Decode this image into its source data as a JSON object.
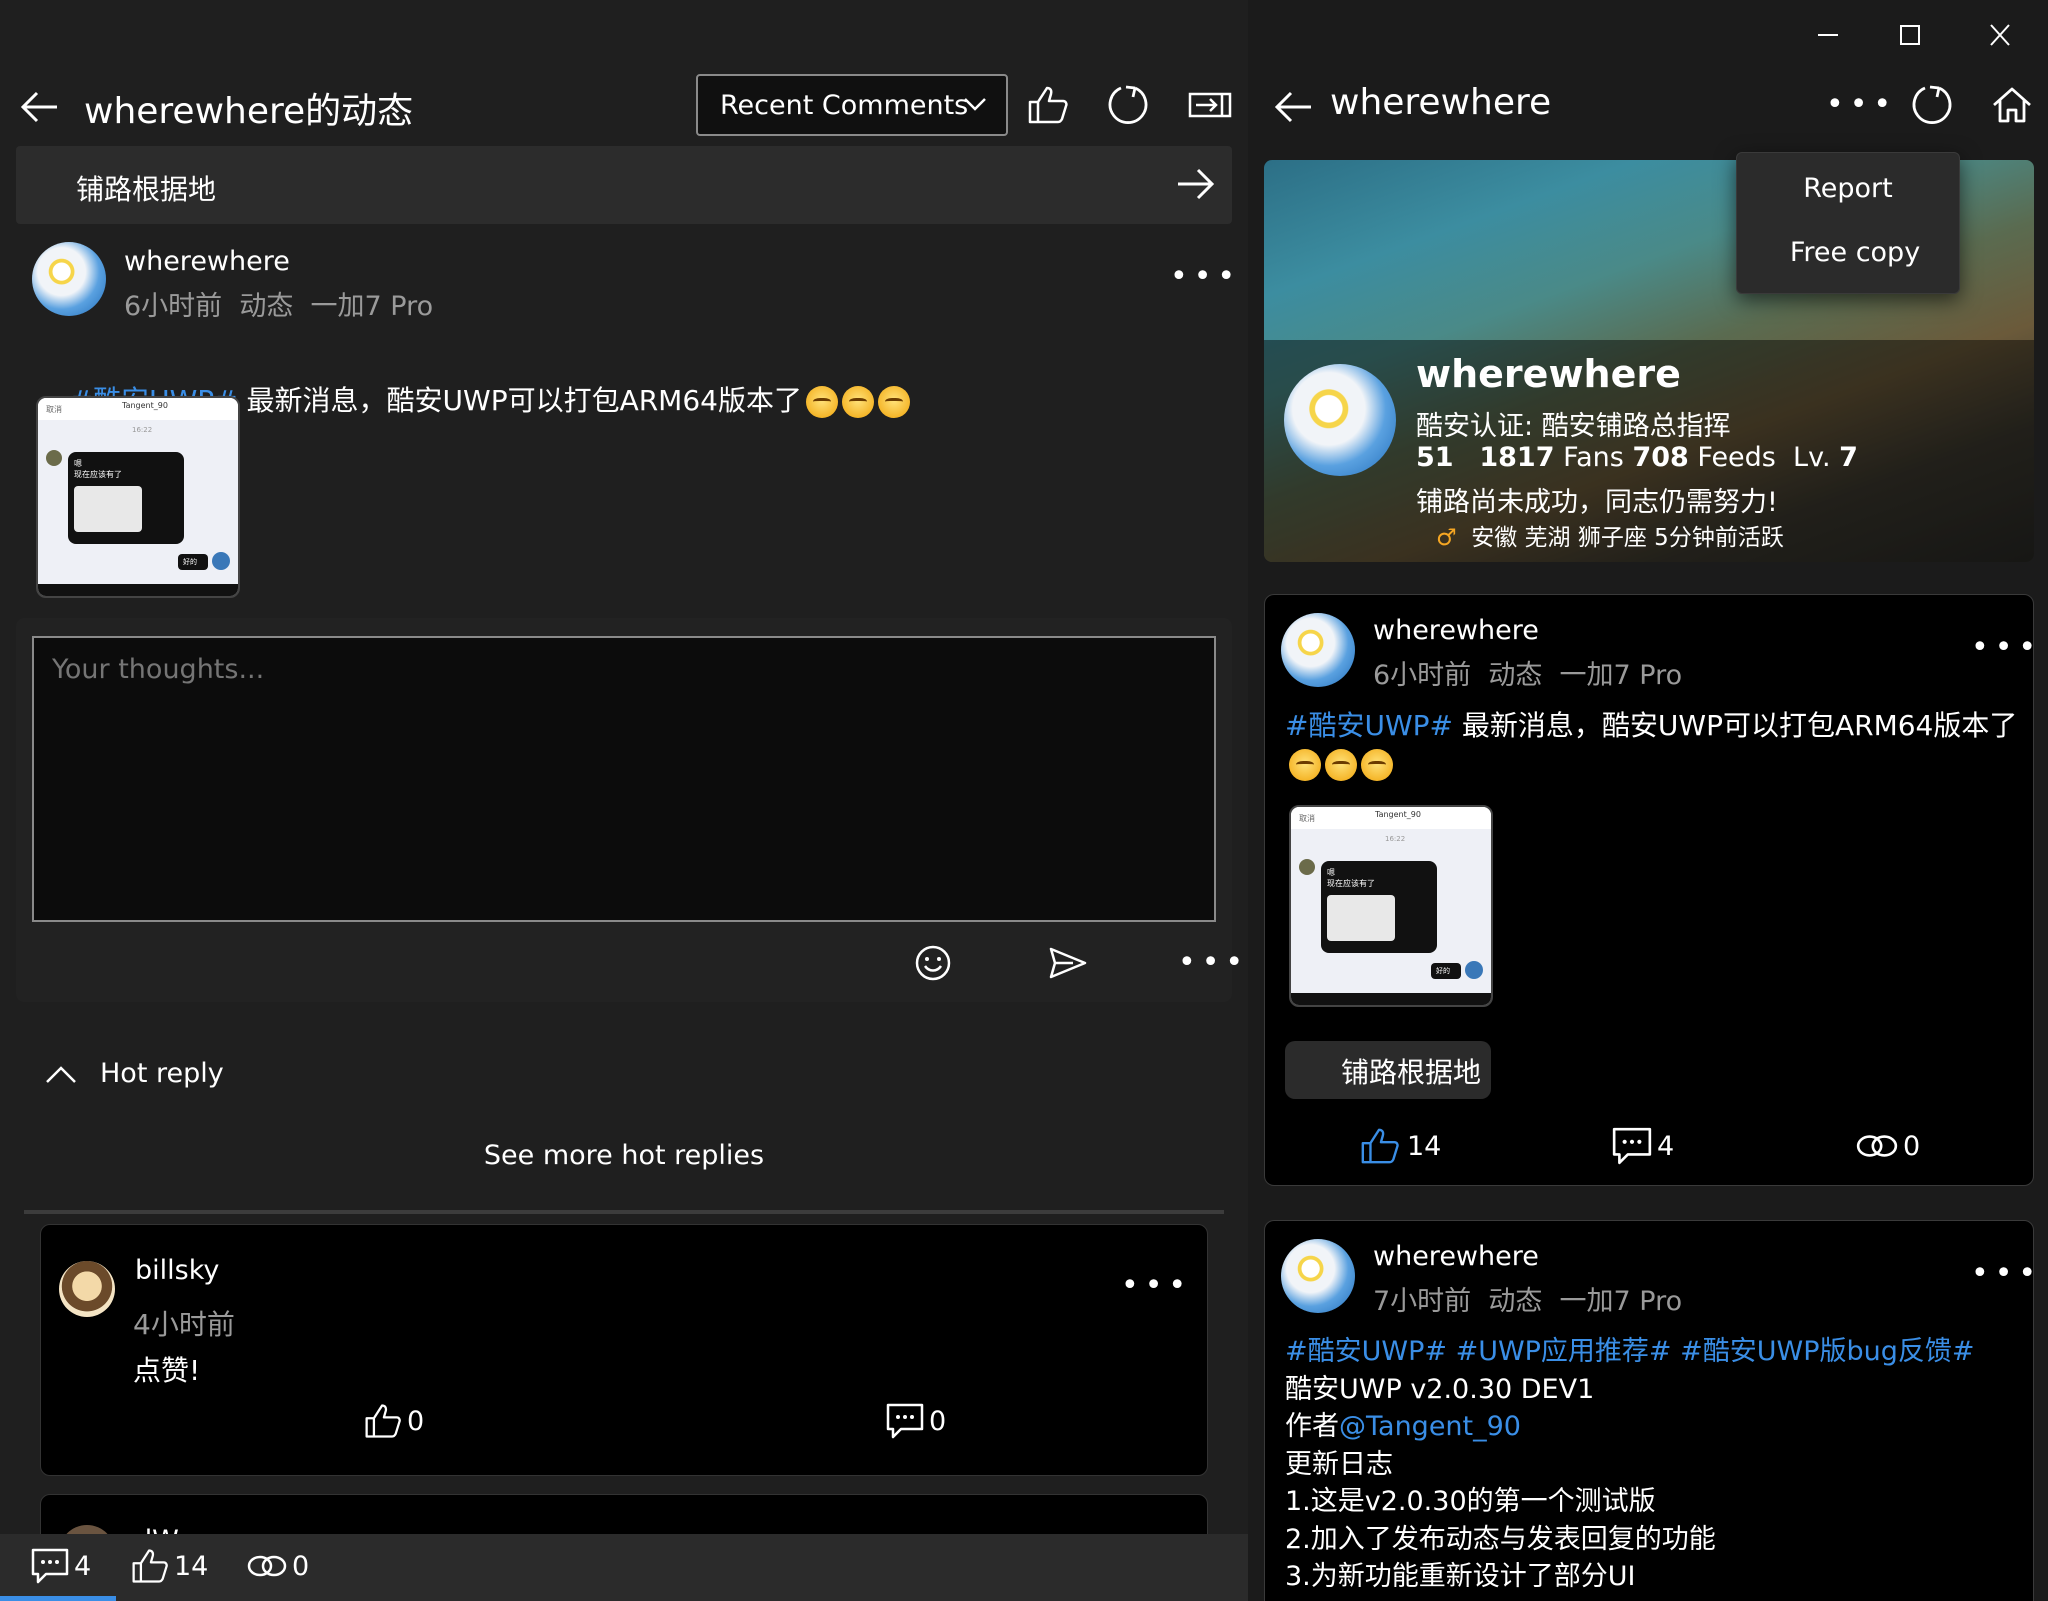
{
  "left": {
    "title": "wherewhere的动态",
    "sort_select": "Recent Comments",
    "topic_bar": "铺路根据地",
    "post": {
      "author": "wherewhere",
      "meta": "6小时前  动态  一加7 Pro",
      "tag": "#酷安UWP#",
      "text": " 最新消息，酷安UWP可以打包ARM64版本了"
    },
    "composer": {
      "placeholder": "Your thoughts..."
    },
    "hot_reply_label": "Hot reply",
    "see_more_label": "See more hot replies",
    "comment": {
      "author": "billsky",
      "time": "4小时前",
      "text": "点赞!",
      "likes": "0",
      "replies": "0"
    },
    "next_comment_partial": "dW",
    "bottom_bar": {
      "comments": "4",
      "likes": "14",
      "shares": "0"
    }
  },
  "right": {
    "title": "wherewhere",
    "menu": {
      "report": "Report",
      "free_copy": "Free copy"
    },
    "profile": {
      "name": "wherewhere",
      "verify": "酷安认证: 酷安铺路总指挥",
      "follow_count": "51",
      "fans_count": "1817",
      "fans_label": " Fans ",
      "feeds_count": "708",
      "feeds_label": " Feeds  Lv. ",
      "level": "7",
      "bio": "铺路尚未成功，同志仍需努力!",
      "gender_symbol": "♂",
      "location": "安徽 芜湖 狮子座 5分钟前活跃"
    },
    "feed1": {
      "author": "wherewhere",
      "meta": "6小时前  动态  一加7 Pro",
      "tag": "#酷安UWP#",
      "text": " 最新消息，酷安UWP可以打包ARM64版本了",
      "topic": "铺路根据地",
      "likes": "14",
      "comments": "4",
      "shares": "0"
    },
    "feed2": {
      "author": "wherewhere",
      "meta": "7小时前  动态  一加7 Pro",
      "tags": "#酷安UWP# #UWP应用推荐# #酷安UWP版bug反馈#",
      "line1": "酷安UWP v2.0.30 DEV1",
      "author_prefix": "作者",
      "mention": "@Tangent_90",
      "line3": "更新日志",
      "line4": "1.这是v2.0.30的第一个测试版",
      "line5": "2.加入了发布动态与发表回复的功能",
      "line6": "3.为新功能重新设计了部分UI"
    }
  },
  "thumb": {
    "top_left": "取消",
    "user": "Tangent_90",
    "time": "16:22",
    "msg1": "嗯",
    "msg2": "现在应该有了",
    "reply": "好的"
  }
}
